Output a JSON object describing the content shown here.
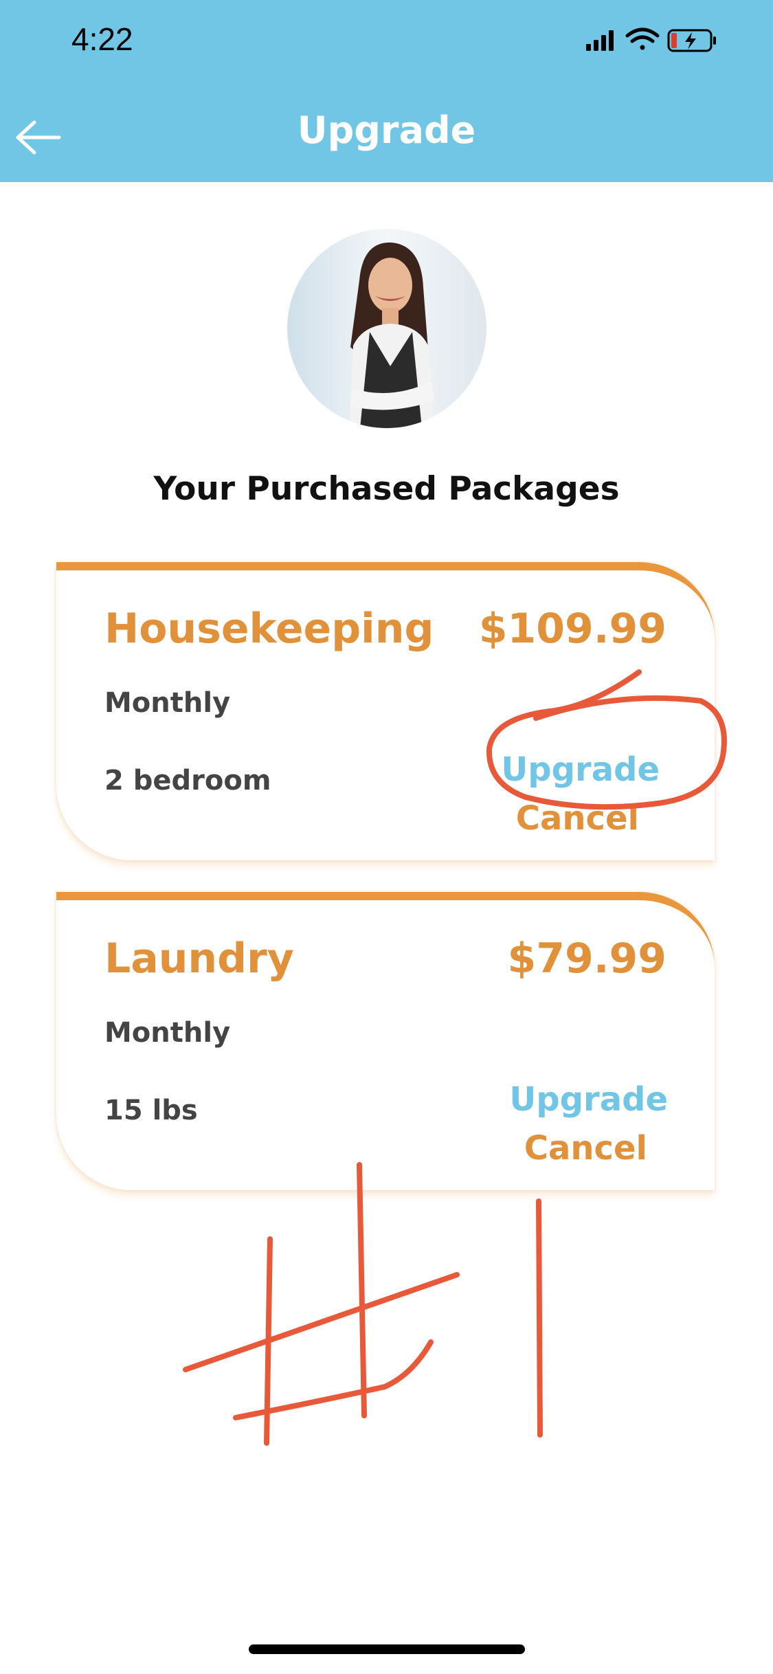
{
  "status_bar": {
    "time": "4:22"
  },
  "nav": {
    "title": "Upgrade",
    "back_icon": "arrow-left-icon"
  },
  "section_title": "Your Purchased Packages",
  "packages": [
    {
      "name": "Housekeeping",
      "price": "$109.99",
      "frequency": "Monthly",
      "detail": "2 bedroom",
      "upgrade_label": "Upgrade",
      "cancel_label": "Cancel"
    },
    {
      "name": "Laundry",
      "price": "$79.99",
      "frequency": "Monthly",
      "detail": "15 lbs",
      "upgrade_label": "Upgrade",
      "cancel_label": "Cancel"
    }
  ],
  "colors": {
    "header": "#71c5e5",
    "accent_orange": "#e0913a",
    "annotation_red": "#e8593a"
  }
}
